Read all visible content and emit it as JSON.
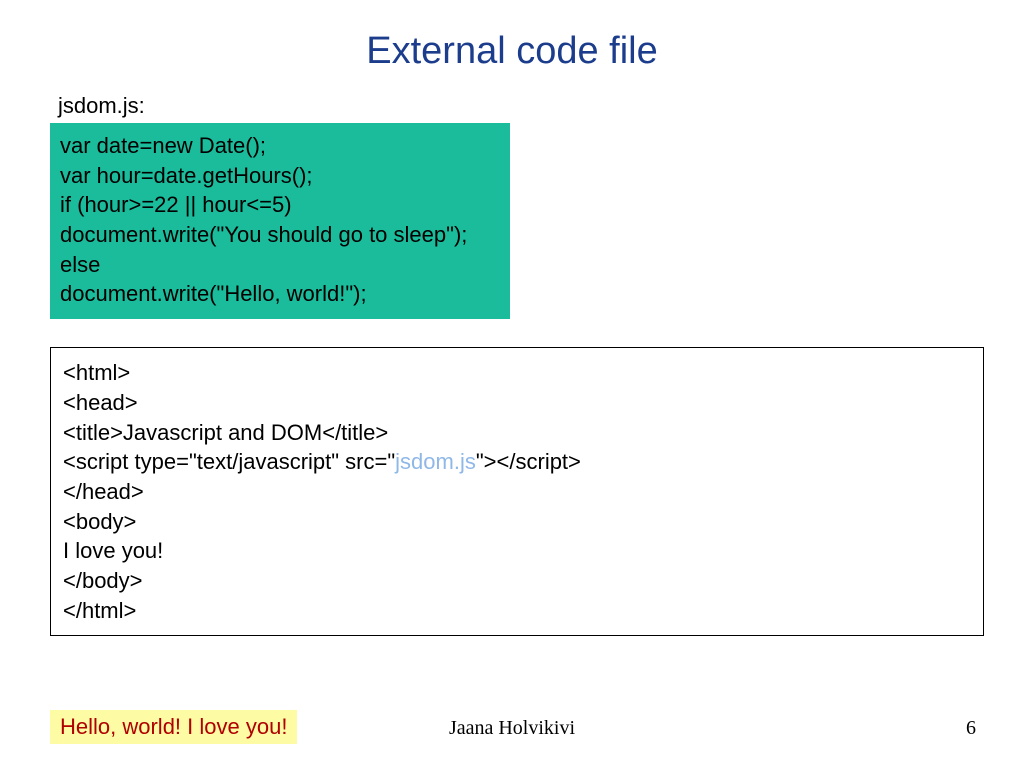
{
  "title": "External code file",
  "js_filename_label": "jsdom.js:",
  "js_code": {
    "l1": "var date=new Date();",
    "l2": "var hour=date.getHours();",
    "l3": "if (hour>=22 || hour<=5)",
    "l4": "document.write(\"You should go to sleep\");",
    "l5": "else",
    "l6": "document.write(\"Hello, world!\");"
  },
  "html_code": {
    "l1": "<html>",
    "l2": "<head>",
    "l3": "<title>Javascript and DOM</title>",
    "l4a": "<script type=\"text/javascript\" src=\"",
    "l4link": "jsdom.js",
    "l4b": "\"></scr",
    "l4c": "ipt>",
    "l5": "</head>",
    "l6": "<body>",
    "l7": "I love you!",
    "l8": "</body>",
    "l9": "</html>"
  },
  "output_text": "Hello, world! I love you!",
  "footer": {
    "author": "Jaana Holvikivi",
    "page": "6"
  }
}
